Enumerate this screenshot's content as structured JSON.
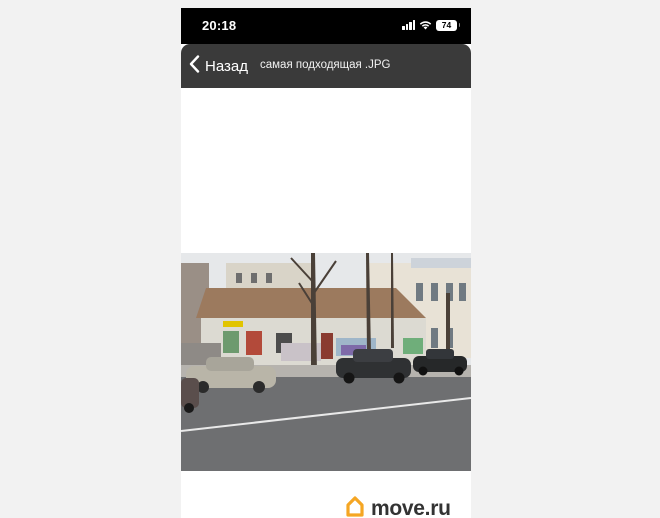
{
  "status_bar": {
    "time": "20:18",
    "battery": "74",
    "icons": [
      "cellular-signal-icon",
      "wifi-icon",
      "battery-icon"
    ]
  },
  "nav": {
    "back_label": "Назад",
    "back_icon": "chevron-left-icon",
    "file_title": "самая подходящая .JPG"
  },
  "photo": {
    "description_icon": "street-photo",
    "watermark": {
      "text": "move.ru",
      "logo_icon": "house-logo-icon",
      "logo_color": "#f5a623"
    }
  },
  "colors": {
    "status_bar": "#000000",
    "nav_bar": "#3a3a3a",
    "page_background": "#f2f2f2",
    "viewer_background": "#ffffff"
  }
}
